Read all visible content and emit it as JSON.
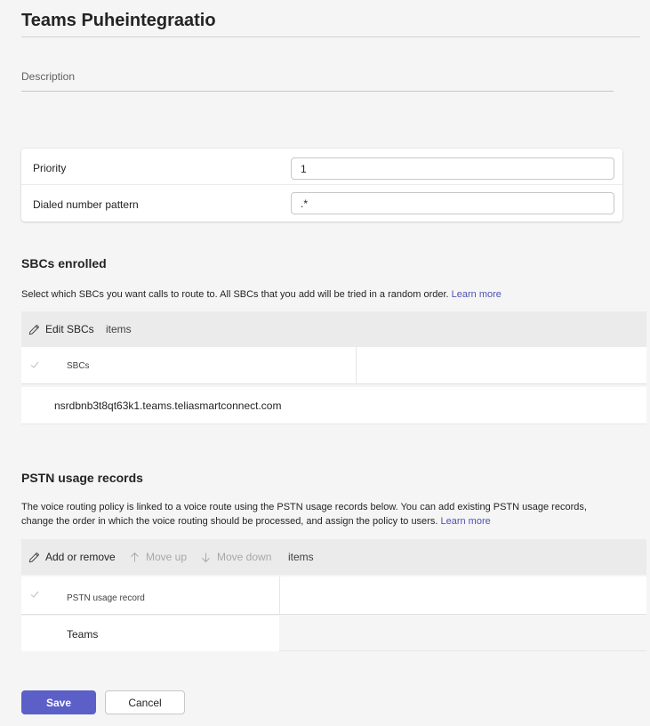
{
  "page": {
    "title": "Teams Puheintegraatio",
    "description_label": "Description"
  },
  "form": {
    "priority_label": "Priority",
    "priority_value": "1",
    "pattern_label": "Dialed number pattern",
    "pattern_value": ".*"
  },
  "sbcs": {
    "title": "SBCs enrolled",
    "description": "Select which SBCs you want calls to route to. All SBCs that you add will be tried in a random order.",
    "learn_more": "Learn more",
    "toolbar": {
      "edit_label": "Edit SBCs",
      "items_label": "items"
    },
    "column_header": "SBCs",
    "rows": [
      "nsrdbnb3t8qt63k1.teams.teliasmartconnect.com"
    ]
  },
  "pstn": {
    "title": "PSTN usage records",
    "description_line1": "The voice routing policy is linked to a voice route using the PSTN usage records below. You can add existing PSTN usage records,",
    "description_line2": "change the order in which the voice routing should be processed, and assign the policy to users.",
    "learn_more": "Learn more",
    "toolbar": {
      "add_remove_label": "Add or remove",
      "move_up_label": "Move up",
      "move_down_label": "Move down",
      "items_label": "items"
    },
    "column_header": "PSTN usage record",
    "rows": [
      "Teams"
    ]
  },
  "actions": {
    "save_label": "Save",
    "cancel_label": "Cancel"
  },
  "colors": {
    "accent": "#5b5fc7",
    "link": "#4f52b2"
  },
  "icons": {
    "edit": "pencil-icon",
    "up": "arrow-up-icon",
    "down": "arrow-down-icon",
    "check": "checkmark-icon"
  }
}
